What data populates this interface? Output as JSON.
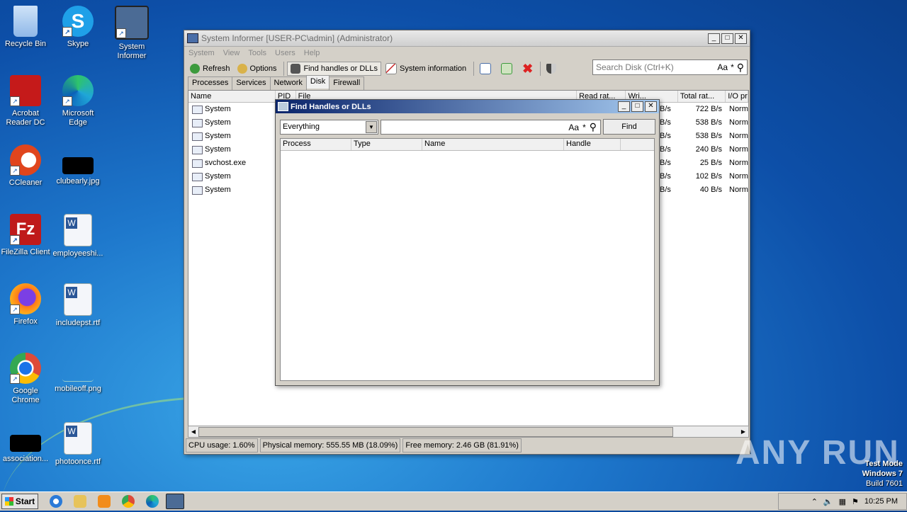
{
  "desktop": {
    "icons": [
      {
        "label": "Recycle Bin",
        "icon": "recycle-bin-icon",
        "color": "#8fb8e8"
      },
      {
        "label": "Skype",
        "icon": "skype-icon",
        "color": "#1fa0e8"
      },
      {
        "label": "System Informer",
        "icon": "system-informer-icon",
        "color": "#4b6b95"
      },
      {
        "label": "Acrobat Reader DC",
        "icon": "acrobat-icon",
        "color": "#c51a1a"
      },
      {
        "label": "Microsoft Edge",
        "icon": "edge-icon",
        "color": "#1fa6d8"
      },
      {
        "label": "CCleaner",
        "icon": "ccleaner-icon",
        "color": "#e0451d"
      },
      {
        "label": "clubearly.jpg",
        "icon": "image-file-icon",
        "color": "#000000"
      },
      {
        "label": "FileZilla Client",
        "icon": "filezilla-icon",
        "color": "#bf1a1a"
      },
      {
        "label": "employeeshi...",
        "icon": "word-document-icon",
        "color": "#2b5797"
      },
      {
        "label": "Firefox",
        "icon": "firefox-icon",
        "color": "#ff7a1a"
      },
      {
        "label": "includepst.rtf",
        "icon": "word-document-icon",
        "color": "#2b5797"
      },
      {
        "label": "Google Chrome",
        "icon": "chrome-icon",
        "color": "#dd4b39"
      },
      {
        "label": "mobileoff.png",
        "icon": "image-file-icon",
        "color": "#1e78cc"
      },
      {
        "label": "association...",
        "icon": "image-file-icon",
        "color": "#000000"
      },
      {
        "label": "photoonce.rtf",
        "icon": "word-document-icon",
        "color": "#2b5797"
      }
    ]
  },
  "main_window": {
    "title": "System Informer [USER-PC\\admin] (Administrator)",
    "menu": [
      "System",
      "View",
      "Tools",
      "Users",
      "Help"
    ],
    "toolbar": {
      "refresh": "Refresh",
      "options": "Options",
      "find_handles": "Find handles or DLLs",
      "system_information": "System information"
    },
    "search_placeholder": "Search Disk (Ctrl+K)",
    "search_case_label": "Aa",
    "search_regex_label": "*",
    "tabs": [
      "Processes",
      "Services",
      "Network",
      "Disk",
      "Firewall"
    ],
    "active_tab": "Disk",
    "columns": [
      "Name",
      "PID",
      "File",
      "Read rat...",
      "Wri...",
      "Total rat...",
      "I/O pr"
    ],
    "rows": [
      {
        "name": "System",
        "write": "B/s",
        "total": "722 B/s",
        "io": "Norm"
      },
      {
        "name": "System",
        "write": "B/s",
        "total": "538 B/s",
        "io": "Norm"
      },
      {
        "name": "System",
        "write": "B/s",
        "total": "538 B/s",
        "io": "Norm"
      },
      {
        "name": "System",
        "write": "B/s",
        "total": "240 B/s",
        "io": "Norm"
      },
      {
        "name": "svchost.exe",
        "write": "B/s",
        "total": "25 B/s",
        "io": "Norm"
      },
      {
        "name": "System",
        "write": "B/s",
        "total": "102 B/s",
        "io": "Norm"
      },
      {
        "name": "System",
        "write": "B/s",
        "total": "40 B/s",
        "io": "Norm"
      }
    ],
    "status": {
      "cpu": "CPU usage: 1.60%",
      "physical": "Physical memory: 555.55 MB (18.09%)",
      "free": "Free memory: 2.46 GB (81.91%)"
    }
  },
  "dialog": {
    "title": "Find Handles or DLLs",
    "filter_selected": "Everything",
    "input_value": "",
    "case_label": "Aa",
    "regex_label": "*",
    "find_label": "Find",
    "columns": [
      "Process",
      "Type",
      "Name",
      "Handle"
    ]
  },
  "taskbar": {
    "start_label": "Start",
    "clock": "10:25 PM",
    "pinned": [
      "internet-explorer-icon",
      "explorer-icon",
      "media-player-icon",
      "chrome-icon",
      "edge-icon",
      "system-informer-icon"
    ]
  },
  "watermark": {
    "line1": "Test Mode",
    "line2": "Windows 7",
    "line3": "Build 7601",
    "brand": "ANY RUN"
  }
}
